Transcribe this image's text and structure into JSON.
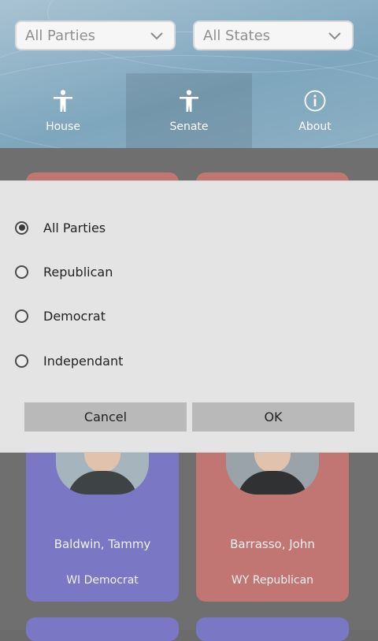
{
  "filters": {
    "party_value": "All Parties",
    "state_value": "All States"
  },
  "tabs": [
    {
      "label": "House",
      "icon": "person-icon",
      "active": false
    },
    {
      "label": "Senate",
      "icon": "person-icon",
      "active": true
    },
    {
      "label": "About",
      "icon": "info-icon",
      "active": false
    }
  ],
  "cards": [
    {
      "name": "Baldwin, Tammy",
      "state_party": "WI Democrat",
      "color": "#7a78c4"
    },
    {
      "name": "Barrasso, John",
      "state_party": "WY Republican",
      "color": "#c27674"
    }
  ],
  "dialog": {
    "options": [
      {
        "label": "All Parties",
        "selected": true
      },
      {
        "label": "Republican",
        "selected": false
      },
      {
        "label": "Democrat",
        "selected": false
      },
      {
        "label": "Independant",
        "selected": false
      }
    ],
    "cancel_label": "Cancel",
    "ok_label": "OK"
  },
  "colors": {
    "democrat": "#7a78c4",
    "republican": "#c27674",
    "dialog_bg": "#e4e4e4"
  }
}
